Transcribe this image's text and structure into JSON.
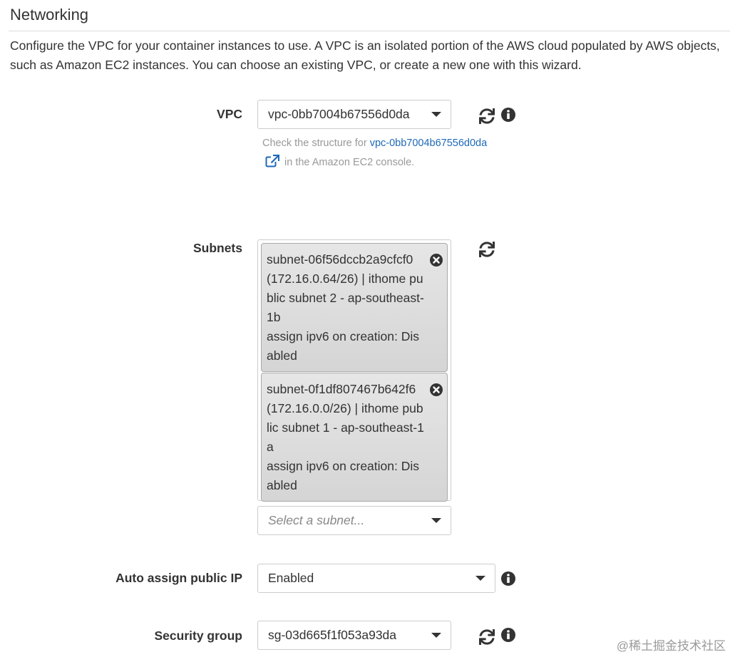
{
  "section": {
    "title": "Networking",
    "description": "Configure the VPC for your container instances to use. A VPC is an isolated portion of the AWS cloud populated by AWS objects, such as Amazon EC2 instances. You can choose an existing VPC, or create a new one with this wizard."
  },
  "vpc": {
    "label": "VPC",
    "selected": "vpc-0bb7004b67556d0da",
    "help_prefix": "Check the structure for ",
    "help_link": "vpc-0bb7004b67556d0da",
    "help_suffix": " in the Amazon EC2 console.",
    "refresh_icon": "refresh-icon",
    "info_icon": "info-icon"
  },
  "subnets": {
    "label": "Subnets",
    "refresh_icon": "refresh-icon",
    "selected": [
      {
        "lines": [
          "subnet-06f56dccb2a9cfcf0",
          "(172.16.0.64/26) | ithome public subnet 2 - ap-southeast-1b",
          "assign ipv6 on creation: Disabled"
        ]
      },
      {
        "lines": [
          "subnet-0f1df807467b642f6",
          "(172.16.0.0/26) | ithome public subnet 1 - ap-southeast-1a",
          "assign ipv6 on creation: Disabled"
        ]
      }
    ],
    "select_placeholder": "Select a subnet..."
  },
  "auto_assign_ip": {
    "label": "Auto assign public IP",
    "selected": "Enabled",
    "info_icon": "info-icon"
  },
  "security_group": {
    "label": "Security group",
    "selected": "sg-03d665f1f053a93da",
    "refresh_icon": "refresh-icon",
    "info_icon": "info-icon"
  },
  "watermark": "@稀土掘金技术社区",
  "colors": {
    "link": "#1e69b9",
    "chip_background": "#dcdcdc",
    "muted_text": "#999999"
  }
}
